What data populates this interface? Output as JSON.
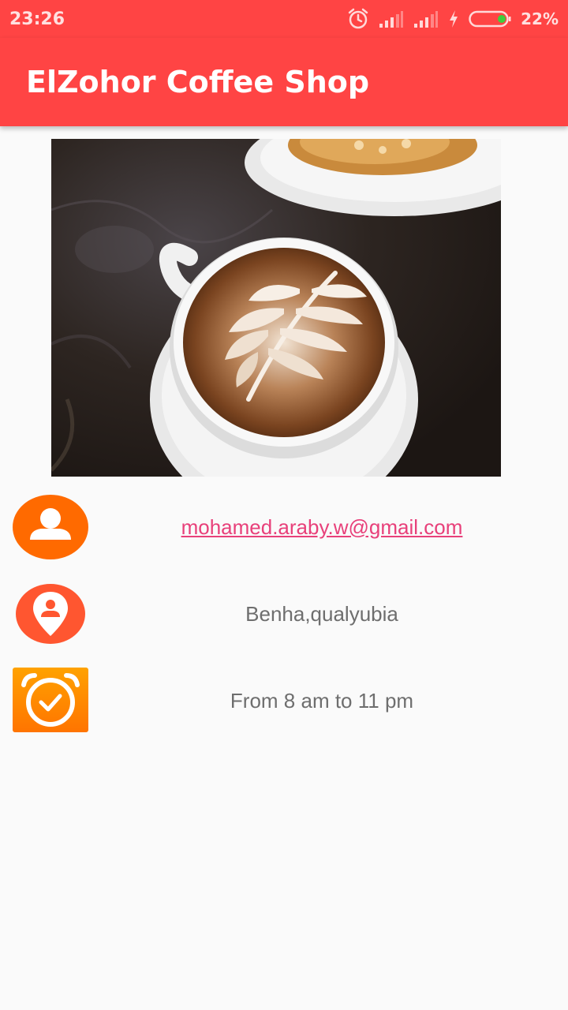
{
  "status_bar": {
    "time": "23:26",
    "battery": "22%",
    "icons": [
      "alarm-icon",
      "signal-icon",
      "signal-icon",
      "charging-icon",
      "battery-icon"
    ]
  },
  "app_bar": {
    "title": "ElZohor Coffee Shop"
  },
  "hero": {
    "icon": "coffee-photo"
  },
  "contact": [
    {
      "icon": "person-icon",
      "text": "mohamed.araby.w@gmail.com",
      "link": true
    },
    {
      "icon": "location-pin-icon",
      "text": "Benha,qualyubia",
      "link": false
    },
    {
      "icon": "alarm-clock-icon",
      "text": "From 8 am to 11 pm",
      "link": false
    }
  ],
  "colors": {
    "primary": "#ff4444",
    "link": "#e8407a",
    "icon_orange": "#ff6a00",
    "icon_red_orange": "#ff5630",
    "text_gray": "#6e6e6e",
    "background": "#fafafa"
  }
}
